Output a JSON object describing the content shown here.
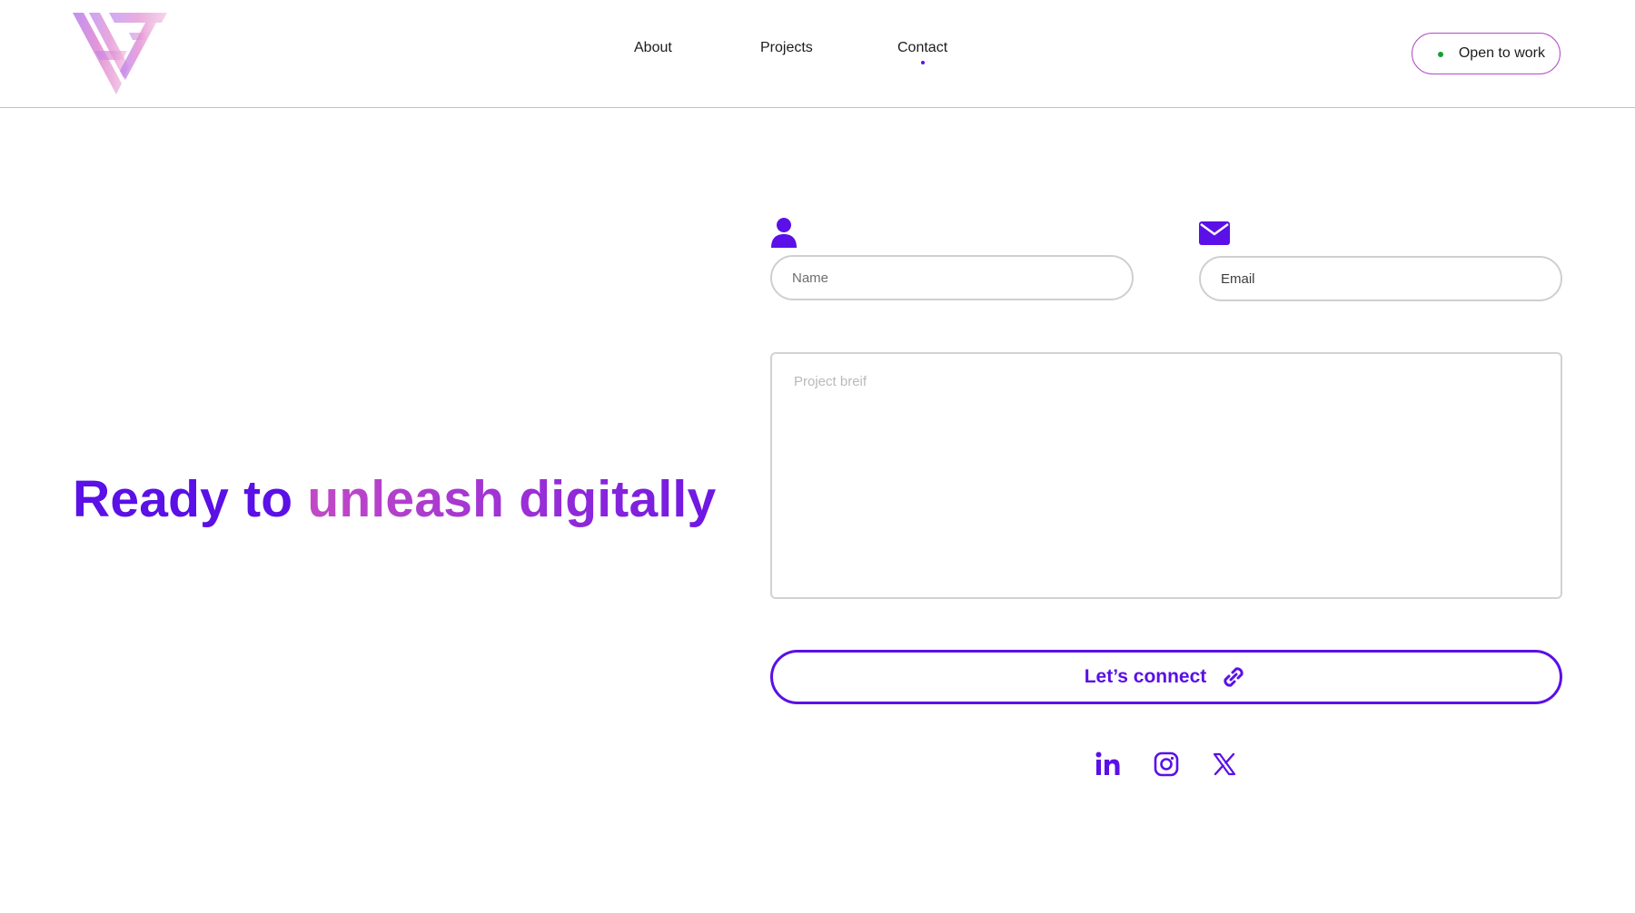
{
  "header": {
    "nav": [
      {
        "label": "About"
      },
      {
        "label": "Projects"
      },
      {
        "label": "Contact",
        "active": true
      }
    ],
    "status": {
      "label": "Open to work",
      "dot_color": "#12a12e"
    }
  },
  "hero": {
    "headline_part1": "Ready to ",
    "headline_part2": "unleash digitally"
  },
  "form": {
    "name_placeholder": "Name",
    "email_placeholder": "Email",
    "brief_placeholder": "Project breif",
    "submit_label": "Let’s connect"
  },
  "icons": {
    "name_field": "user-icon",
    "email_field": "envelope-icon",
    "submit": "link-icon",
    "socials": [
      "linkedin-icon",
      "instagram-icon",
      "x-icon"
    ]
  },
  "colors": {
    "accent": "#5a10e6",
    "gradient_pink": "#c24ac6",
    "border_pink": "#e6a9e6",
    "input_border": "#cfcfcf"
  }
}
